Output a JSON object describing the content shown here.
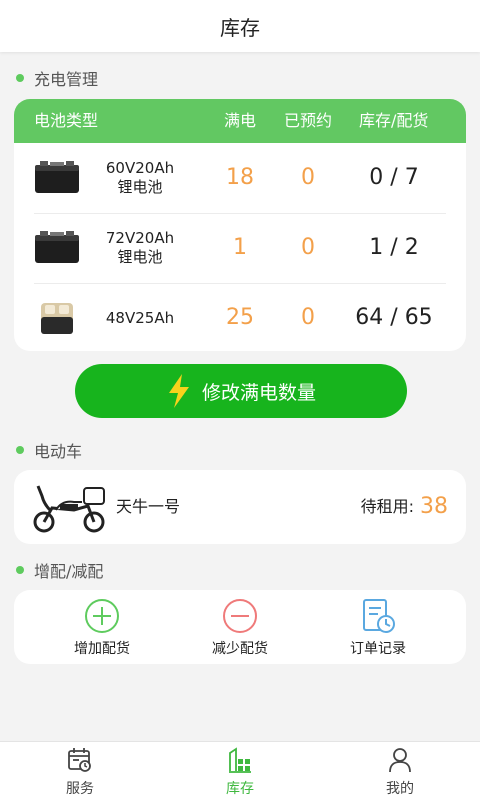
{
  "header": {
    "title": "库存"
  },
  "charging": {
    "section_title": "充电管理",
    "columns": {
      "type": "电池类型",
      "full": "满电",
      "reserved": "已预约",
      "stock": "库存/配货"
    },
    "rows": [
      {
        "name_line1": "60V20Ah",
        "name_line2": "锂电池",
        "full": "18",
        "reserved": "0",
        "stock": "0 / 7",
        "icon": "black-battery-icon"
      },
      {
        "name_line1": "72V20Ah",
        "name_line2": "锂电池",
        "full": "1",
        "reserved": "0",
        "stock": "1 / 2",
        "icon": "black-battery-icon"
      },
      {
        "name_line1": "48V25Ah",
        "name_line2": "",
        "full": "25",
        "reserved": "0",
        "stock": "64 / 65",
        "icon": "beige-battery-icon"
      }
    ],
    "edit_button_label": "修改满电数量"
  },
  "ebike": {
    "section_title": "电动车",
    "name": "天牛一号",
    "rent_label": "待租用:",
    "rent_count": "38"
  },
  "adjust": {
    "section_title": "增配/减配",
    "actions": [
      {
        "label": "增加配货",
        "icon": "plus-circle-icon"
      },
      {
        "label": "减少配货",
        "icon": "minus-circle-icon"
      },
      {
        "label": "订单记录",
        "icon": "order-record-icon"
      }
    ]
  },
  "tabs": [
    {
      "label": "服务",
      "icon": "calendar-icon"
    },
    {
      "label": "库存",
      "icon": "inventory-icon"
    },
    {
      "label": "我的",
      "icon": "user-icon"
    }
  ],
  "colors": {
    "accent": "#62c862",
    "button": "#17b41d",
    "number": "#f3a04a",
    "active_tab": "#3fb83f"
  }
}
